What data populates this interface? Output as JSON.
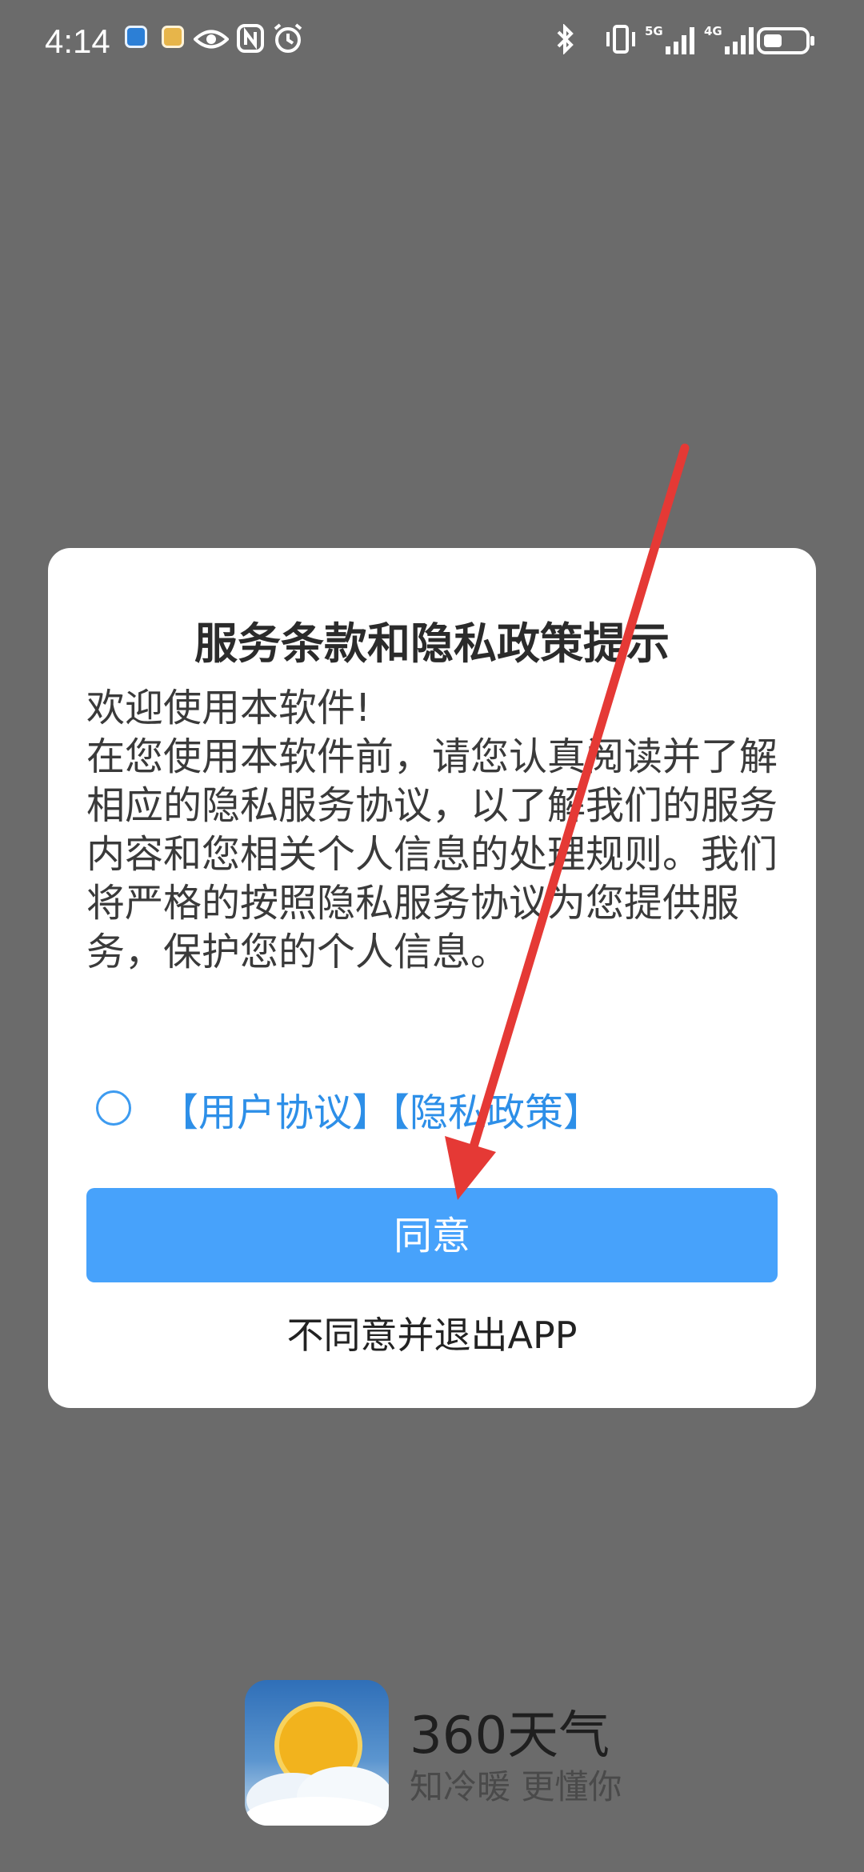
{
  "status_bar": {
    "time": "4:14",
    "icons": [
      "app-icon",
      "app-icon",
      "eye-icon",
      "nfc-icon",
      "alarm-icon",
      "bluetooth-icon",
      "vibrate-icon",
      "signal-5g-icon",
      "signal-4g-icon",
      "battery-icon"
    ],
    "network_1": "5G",
    "network_2": "4G"
  },
  "dialog": {
    "title": "服务条款和隐私政策提示",
    "body_lines": [
      "欢迎使用本软件!",
      "在您使用本软件前，请您认真阅读并了解相应的隐私服务协议，以了解我们的服务内容和您相关个人信息的处理规则。我们将严格的按照隐私服务协议为您提供服务，保护您的个人信息。"
    ],
    "user_agreement_link": "【用户协议】",
    "privacy_policy_link": "【隐私政策】",
    "agree_button": "同意",
    "disagree_link": "不同意并退出APP"
  },
  "brand": {
    "name": "360天气",
    "slogan": "知冷暖 更懂你"
  },
  "colors": {
    "overlay": "#6b6b6b",
    "accent": "#47a2fb",
    "link": "#2d8fe8",
    "annotation_arrow": "#e53935"
  }
}
